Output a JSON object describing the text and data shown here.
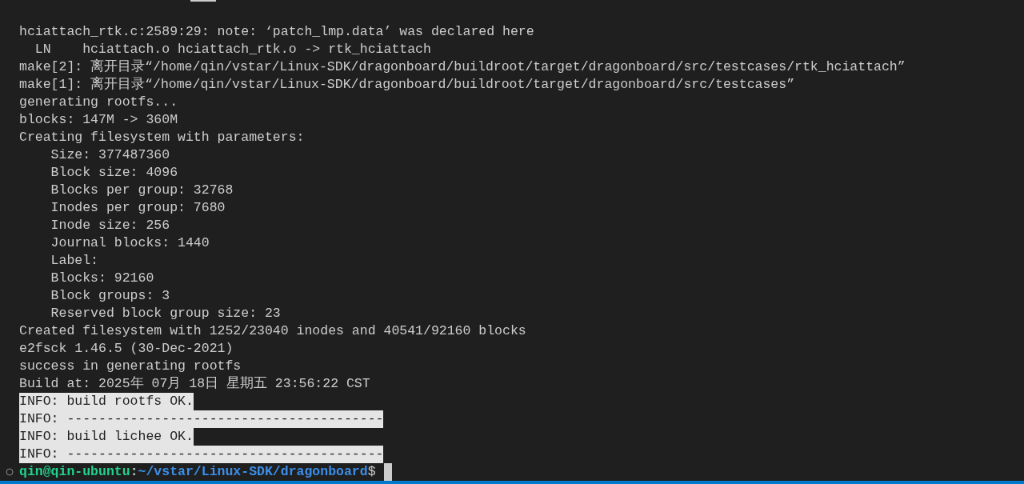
{
  "terminal": {
    "lines": [
      {
        "text": "hciattach_rtk.c:2589:29: note: ‘patch_lmp.data’ was declared here",
        "selected": false
      },
      {
        "text": "  LN    hciattach.o hciattach_rtk.o -> rtk_hciattach",
        "selected": false
      },
      {
        "text": "make[2]: 离开目录“/home/qin/vstar/Linux-SDK/dragonboard/buildroot/target/dragonboard/src/testcases/rtk_hciattach”",
        "selected": false
      },
      {
        "text": "make[1]: 离开目录“/home/qin/vstar/Linux-SDK/dragonboard/buildroot/target/dragonboard/src/testcases”",
        "selected": false
      },
      {
        "text": "generating rootfs...",
        "selected": false
      },
      {
        "text": "blocks: 147M -> 360M",
        "selected": false
      },
      {
        "text": "Creating filesystem with parameters:",
        "selected": false
      },
      {
        "text": "    Size: 377487360",
        "selected": false
      },
      {
        "text": "    Block size: 4096",
        "selected": false
      },
      {
        "text": "    Blocks per group: 32768",
        "selected": false
      },
      {
        "text": "    Inodes per group: 7680",
        "selected": false
      },
      {
        "text": "    Inode size: 256",
        "selected": false
      },
      {
        "text": "    Journal blocks: 1440",
        "selected": false
      },
      {
        "text": "    Label:",
        "selected": false
      },
      {
        "text": "    Blocks: 92160",
        "selected": false
      },
      {
        "text": "    Block groups: 3",
        "selected": false
      },
      {
        "text": "    Reserved block group size: 23",
        "selected": false
      },
      {
        "text": "Created filesystem with 1252/23040 inodes and 40541/92160 blocks",
        "selected": false
      },
      {
        "text": "e2fsck 1.46.5 (30-Dec-2021)",
        "selected": false
      },
      {
        "text": "success in generating rootfs",
        "selected": false
      },
      {
        "text": "Build at: 2025年 07月 18日 星期五 23:56:22 CST",
        "selected": false
      },
      {
        "text": "INFO: build rootfs OK.",
        "selected": true
      },
      {
        "text": "INFO: ----------------------------------------",
        "selected": true
      },
      {
        "text": "INFO: build lichee OK.",
        "selected": true
      },
      {
        "text": "INFO: ----------------------------------------",
        "selected": true
      }
    ],
    "prompt": {
      "user_host": "qin@qin-ubuntu",
      "separator": ":",
      "path": "~/vstar/Linux-SDK/dragonboard",
      "symbol": "$"
    }
  }
}
